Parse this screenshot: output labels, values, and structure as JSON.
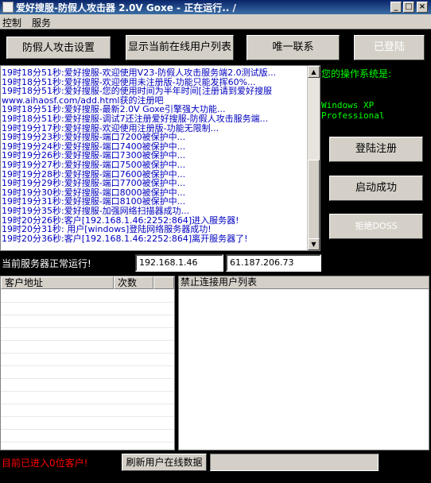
{
  "window": {
    "title": "爱好搜服-防假人攻击器 2.0V Goxe - 正在运行.. /"
  },
  "menu": [
    "控制",
    "服务"
  ],
  "top_buttons": {
    "anti_fake": "防假人攻击设置",
    "show_users": "显示当前在线用户列表",
    "contact": "唯一联系",
    "logged_in": "已登陆"
  },
  "log": [
    "19时18分51秒:爱好搜服-欢迎使用V23-防假人攻击服务端2.0测试版...",
    "19时18分51秒:爱好搜服-欢迎使用未注册版-功能只能发挥60%...",
    "19时18分51秒:爱好搜服-您的使用时间为半年时间[注册请到爱好搜服",
    "www.aihaosf.com/add.html获的注册吧",
    "19时18分51秒:爱好搜服-最新2.0V Goxe引擎强大功能...",
    "19时18分51秒:爱好搜服-调试7还注册爱好搜服-防假人攻击服务端...",
    "19时19分17秒:爱好搜服-欢迎使用注册版-功能无限制...",
    "19时19分23秒:爱好搜服-端口7200被保护中...",
    "19时19分24秒:爱好搜服-端口7400被保护中...",
    "19时19分26秒:爱好搜服-端口7300被保护中...",
    "19时19分27秒:爱好搜服-端口7500被保护中...",
    "19时19分28秒:爱好搜服-端口7600被保护中...",
    "19时19分29秒:爱好搜服-端口7700被保护中...",
    "19时19分30秒:爱好搜服-端口8000被保护中...",
    "19时19分31秒:爱好搜服-端口8100被保护中...",
    "19时19分35秒:爱好搜服-加强网络扫描器成功...",
    "19时20分26秒:客户[192.168.1.46:2252:864]进入服务器!",
    "19时20分31秒: 用户[windows]登陆网络服务器成功!",
    "19时20分36秒:客户[192.168.1.46:2252:864]离开服务器了!"
  ],
  "side": {
    "os_label": "您的操作系统是:",
    "os_value": "Windows XP Professional",
    "register": "登陆注册",
    "started": "启动成功",
    "reject": "拒绝DOSS"
  },
  "status": {
    "label": "当前服务器正常运行!",
    "ip_local": "192.168.1.46",
    "ip_remote": "61.187.206.73"
  },
  "client_table": {
    "col_address": "客户地址",
    "col_count": "次数"
  },
  "blocked_list": {
    "header": "禁止连接用户列表"
  },
  "bottom": {
    "client_count": "目前已进入0位客户!",
    "refresh": "刷新用户在线数据"
  },
  "colors": {
    "titlebar": "#0a246a",
    "log_text": "#0000c0",
    "os_text": "#00ff00",
    "warn_text": "#ff0000"
  }
}
